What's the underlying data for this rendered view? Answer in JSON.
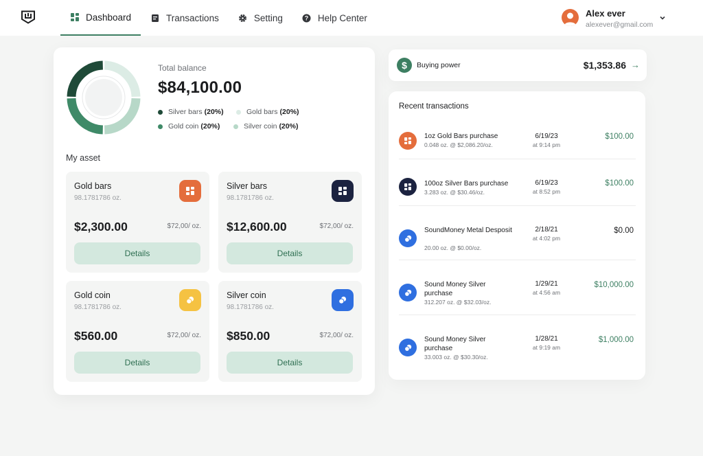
{
  "nav": {
    "items": [
      {
        "label": "Dashboard",
        "active": true
      },
      {
        "label": "Transactions"
      },
      {
        "label": "Setting"
      },
      {
        "label": "Help Center"
      }
    ]
  },
  "user": {
    "name": "Alex ever",
    "email": "alexever@gmail.com"
  },
  "balance": {
    "label": "Total balance",
    "value": "$84,100.00",
    "legend": [
      {
        "name": "Silver bars",
        "pct": "(20%)",
        "color": "#1f4a38"
      },
      {
        "name": "Gold bars",
        "pct": "(20%)",
        "color": "#dcece5"
      },
      {
        "name": "Gold coin",
        "pct": "(20%)",
        "color": "#3f8a68"
      },
      {
        "name": "Silver coin",
        "pct": "(20%)",
        "color": "#b7d8c8"
      }
    ]
  },
  "assets": {
    "title": "My asset",
    "cards": [
      {
        "title": "Gold bars",
        "qty": "98.1781786 oz.",
        "value": "$2,300.00",
        "price": "$72,00/ oz.",
        "button": "Details",
        "icon": "bars-icon",
        "color": "#e46d3c"
      },
      {
        "title": "Silver bars",
        "qty": "98.1781786 oz.",
        "value": "$12,600.00",
        "price": "$72,00/ oz.",
        "button": "Details",
        "icon": "bars-icon",
        "color": "#1c2340"
      },
      {
        "title": "Gold coin",
        "qty": "98.1781786 oz.",
        "value": "$560.00",
        "price": "$72,00/ oz.",
        "button": "Details",
        "icon": "coin-icon",
        "color": "#f5c242"
      },
      {
        "title": "Silver coin",
        "qty": "98.1781786 oz.",
        "value": "$850.00",
        "price": "$72,00/ oz.",
        "button": "Details",
        "icon": "coin-icon",
        "color": "#2f6fe0"
      }
    ]
  },
  "buying_power": {
    "label": "Buying power",
    "value": "$1,353.86",
    "icon": "dollar-icon",
    "arrow": "→"
  },
  "recent": {
    "title": "Recent transactions",
    "items": [
      {
        "name": "1oz Gold Bars purchase",
        "sub": "0.048 oz. @ $2,086.20/oz.",
        "date": "6/19/23",
        "time": "at 9:14 pm",
        "amount": "$100.00",
        "icon": "bars-icon",
        "color": "#e46d3c"
      },
      {
        "name": "100oz Silver Bars purchase",
        "sub": "3.283 oz. @ $30.46/oz.",
        "date": "6/19/23",
        "time": "at 8:52 pm",
        "amount": "$100.00",
        "icon": "bars-icon",
        "color": "#1c2340"
      },
      {
        "name": "SoundMoney Metal Desposit",
        "sub": "20.00 oz. @ $0.00/oz.",
        "date": "2/18/21",
        "time": "at 4:02 pm",
        "amount": "$0.00",
        "icon": "coin-icon",
        "color": "#2f6fe0"
      },
      {
        "name": "Sound Money Silver purchase",
        "sub": "312.207 oz. @ $32.03/oz.",
        "date": "1/29/21",
        "time": "at 4:56 am",
        "amount": "$10,000.00",
        "icon": "coin-icon",
        "color": "#2f6fe0"
      },
      {
        "name": "Sound Money Silver purchase",
        "sub": "33.003 oz. @ $30.30/oz.",
        "date": "1/28/21",
        "time": "at 9:19 am",
        "amount": "$1,000.00",
        "icon": "coin-icon",
        "color": "#2f6fe0"
      }
    ]
  }
}
